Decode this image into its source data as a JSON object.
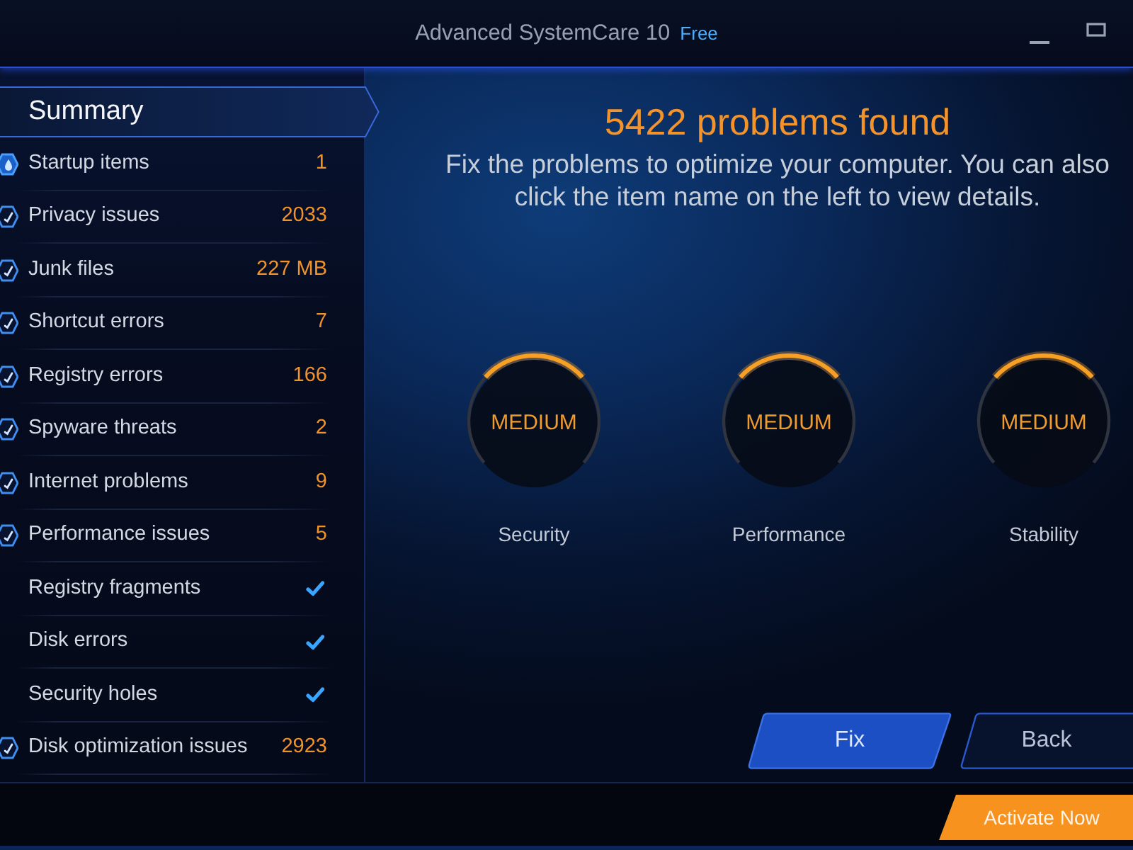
{
  "window": {
    "title": "Advanced SystemCare 10",
    "edition": "Free"
  },
  "sidebar": {
    "items": [
      {
        "kind": "summary",
        "label": "Summary",
        "selected": true
      },
      {
        "kind": "count",
        "label": "Startup items",
        "value": "1",
        "checked": true,
        "partial": true,
        "selected": false
      },
      {
        "kind": "count",
        "label": "Privacy issues",
        "value": "2033",
        "checked": true,
        "partial": false,
        "selected": false
      },
      {
        "kind": "count",
        "label": "Junk files",
        "value": "227 MB",
        "checked": true,
        "partial": false,
        "selected": false
      },
      {
        "kind": "count",
        "label": "Shortcut errors",
        "value": "7",
        "checked": true,
        "partial": false,
        "selected": false
      },
      {
        "kind": "count",
        "label": "Registry errors",
        "value": "166",
        "checked": true,
        "partial": false,
        "selected": false
      },
      {
        "kind": "count",
        "label": "Spyware threats",
        "value": "2",
        "checked": true,
        "partial": false,
        "selected": false
      },
      {
        "kind": "count",
        "label": "Internet problems",
        "value": "9",
        "checked": true,
        "partial": false,
        "selected": false
      },
      {
        "kind": "count",
        "label": "Performance issues",
        "value": "5",
        "checked": true,
        "partial": false,
        "selected": false
      },
      {
        "kind": "ok",
        "label": "Registry fragments",
        "selected": false
      },
      {
        "kind": "ok",
        "label": "Disk errors",
        "selected": false
      },
      {
        "kind": "ok",
        "label": "Security holes",
        "selected": false
      },
      {
        "kind": "count",
        "label": "Disk optimization issues",
        "value": "2923",
        "checked": true,
        "partial": false,
        "selected": false
      }
    ]
  },
  "summary": {
    "heading": "5422 problems found",
    "description": "Fix the problems to optimize your computer. You can also click the item name on the left to view details."
  },
  "gauges": [
    {
      "rating": "MEDIUM",
      "label": "Security"
    },
    {
      "rating": "MEDIUM",
      "label": "Performance"
    },
    {
      "rating": "MEDIUM",
      "label": "Stability"
    }
  ],
  "buttons": [
    {
      "label": "Fix",
      "kind": "primary"
    },
    {
      "label": "Back",
      "kind": "secondary"
    }
  ],
  "footer": {
    "activate_button": "Activate Now"
  }
}
